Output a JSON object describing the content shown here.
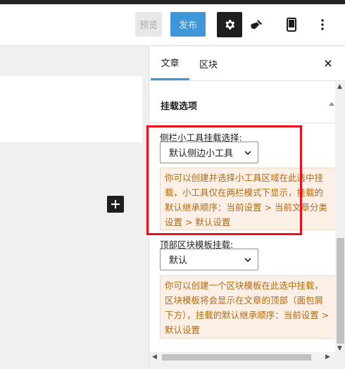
{
  "toolbar": {
    "preview_label": "预览",
    "publish_label": "发布",
    "settings_icon": "gear-icon",
    "style_icon": "brush-icon",
    "mobile_preview_icon": "mobile-icon",
    "more_icon": "more-vertical-icon"
  },
  "canvas": {
    "inserter_icon": "plus-icon"
  },
  "sidebar": {
    "tabs": [
      {
        "label": "文章",
        "active": true
      },
      {
        "label": "区块",
        "active": false
      }
    ],
    "panel_title": "挂载选项",
    "sidebar_widget": {
      "label": "侧栏小工具挂载选择:",
      "selected": "默认侧边小工具",
      "note": "你可以创建并选择小工具区域在此选中挂载，小工具仅在两栏模式下显示，挂载的默认继承顺序：当前设置 > 当前文章分类设置 > 默认设置"
    },
    "top_block": {
      "label": "顶部区块模板挂载:",
      "selected": "默认",
      "note": "你可以创建一个区块模板在此选中挂载，区块模板将会显示在文章的顶部（面包屑下方），挂载的默认继承顺序：当前设置 > 默认设置"
    }
  },
  "colors": {
    "accent": "#3d97d8",
    "note_bg": "#fcf0e6",
    "note_text": "#b06a0f",
    "highlight_border": "#e8101a"
  }
}
